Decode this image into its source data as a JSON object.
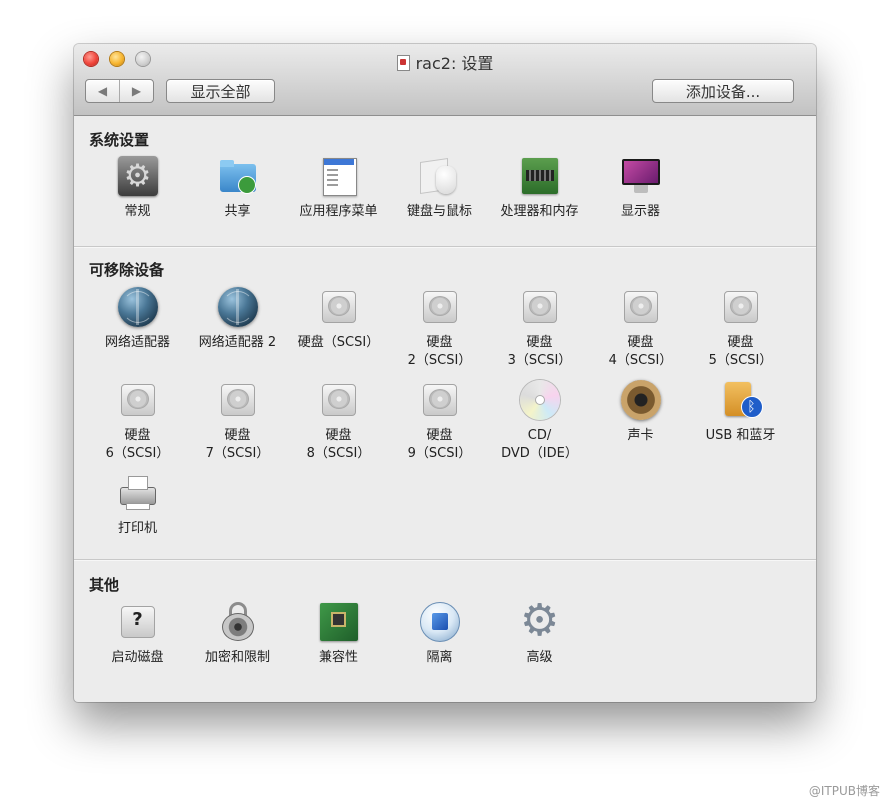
{
  "window": {
    "title": "rac2: 设置",
    "nav_back": "◀",
    "nav_forward": "▶",
    "show_all": "显示全部",
    "add_device": "添加设备..."
  },
  "sections": {
    "system": {
      "title": "系统设置",
      "items": [
        {
          "label": "常规",
          "icon": "gear-panel-icon"
        },
        {
          "label": "共享",
          "icon": "shared-folder-icon"
        },
        {
          "label": "应用程序菜单",
          "icon": "app-menu-icon"
        },
        {
          "label": "键盘与鼠标",
          "icon": "keyboard-mouse-icon"
        },
        {
          "label": "处理器和内存",
          "icon": "memory-chip-icon"
        },
        {
          "label": "显示器",
          "icon": "display-icon"
        }
      ]
    },
    "removable": {
      "title": "可移除设备",
      "items": [
        {
          "label": "网络适配器",
          "icon": "globe-icon"
        },
        {
          "label": "网络适配器 2",
          "icon": "globe-icon"
        },
        {
          "label": "硬盘（SCSI）",
          "icon": "hard-disk-icon"
        },
        {
          "label": "硬盘\n2（SCSI）",
          "icon": "hard-disk-icon"
        },
        {
          "label": "硬盘\n3（SCSI）",
          "icon": "hard-disk-icon"
        },
        {
          "label": "硬盘\n4（SCSI）",
          "icon": "hard-disk-icon"
        },
        {
          "label": "硬盘\n5（SCSI）",
          "icon": "hard-disk-icon"
        },
        {
          "label": "硬盘\n6（SCSI）",
          "icon": "hard-disk-icon"
        },
        {
          "label": "硬盘\n7（SCSI）",
          "icon": "hard-disk-icon"
        },
        {
          "label": "硬盘\n8（SCSI）",
          "icon": "hard-disk-icon"
        },
        {
          "label": "硬盘\n9（SCSI）",
          "icon": "hard-disk-icon"
        },
        {
          "label": "CD/\nDVD（IDE）",
          "icon": "optical-disc-icon"
        },
        {
          "label": "声卡",
          "icon": "speaker-icon"
        },
        {
          "label": "USB 和蓝牙",
          "icon": "usb-bluetooth-icon"
        },
        {
          "label": "打印机",
          "icon": "printer-icon"
        }
      ]
    },
    "other": {
      "title": "其他",
      "items": [
        {
          "label": "启动磁盘",
          "icon": "startup-disk-icon"
        },
        {
          "label": "加密和限制",
          "icon": "lock-icon"
        },
        {
          "label": "兼容性",
          "icon": "motherboard-icon"
        },
        {
          "label": "隔离",
          "icon": "isolation-icon"
        },
        {
          "label": "高级",
          "icon": "advanced-gear-icon"
        }
      ]
    }
  },
  "watermark": "@ITPUB博客"
}
